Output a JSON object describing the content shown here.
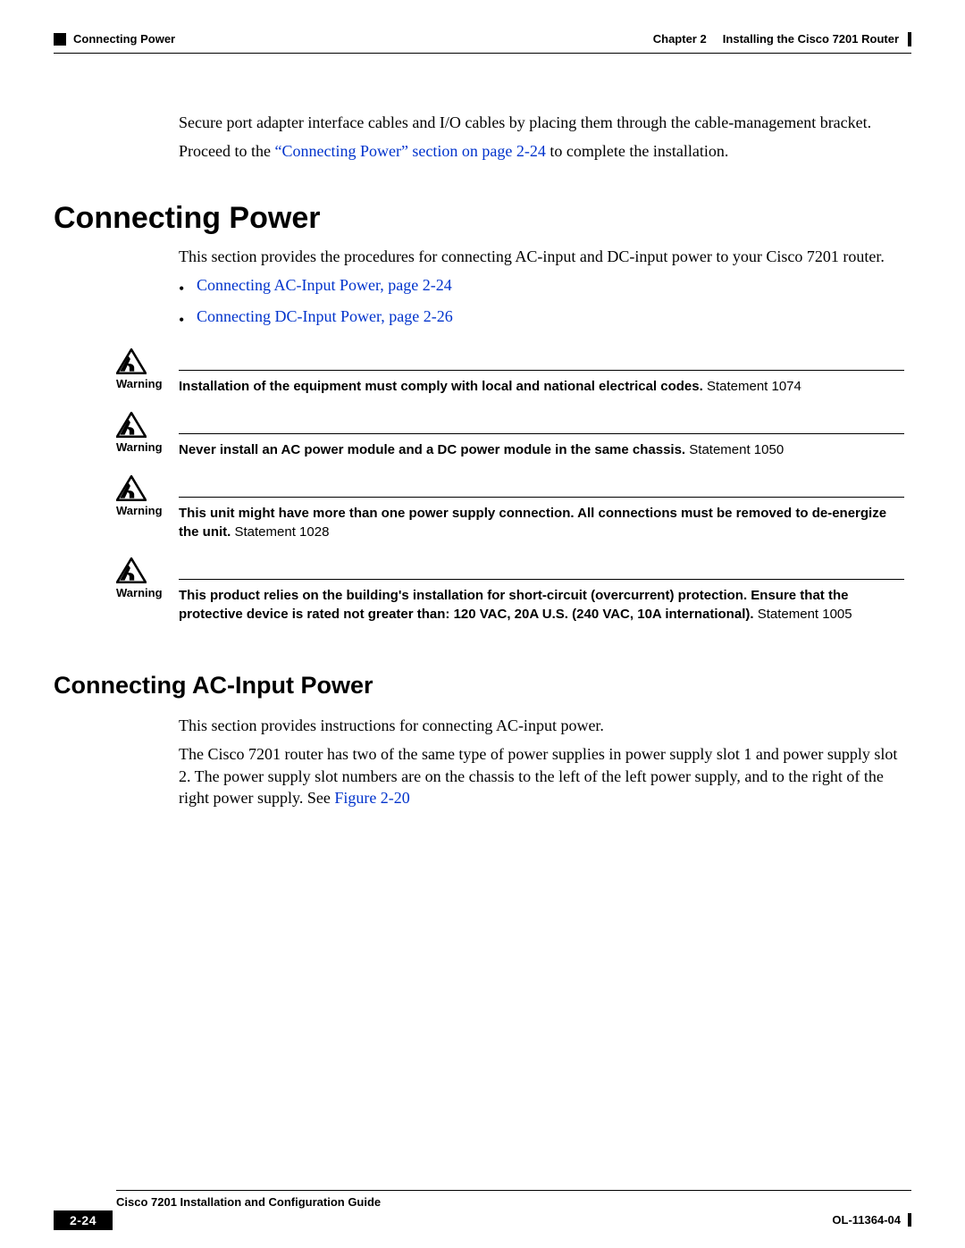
{
  "header": {
    "section_left": "Connecting Power",
    "chapter_label": "Chapter 2",
    "chapter_title": "Installing the Cisco 7201 Router"
  },
  "intro": {
    "p1": "Secure port adapter interface cables and I/O cables by placing them through the cable-management bracket.",
    "p2_pre": "Proceed to the ",
    "p2_link": "“Connecting Power” section on page 2-24",
    "p2_post": " to complete the installation."
  },
  "h1": "Connecting Power",
  "section_intro": "This section provides the procedures for connecting AC-input and DC-input power to your Cisco 7201 router.",
  "bullets": [
    "Connecting AC-Input Power, page 2-24",
    "Connecting DC-Input Power, page 2-26"
  ],
  "warnings": [
    {
      "label": "Warning",
      "bold": "Installation of the equipment must comply with local and national electrical codes.",
      "stmt": "Statement 1074"
    },
    {
      "label": "Warning",
      "bold": "Never install an AC power module and a DC power module in the same chassis.",
      "stmt": "Statement 1050"
    },
    {
      "label": "Warning",
      "bold": "This unit might have more than one power supply connection. All connections must be removed to de-energize the unit.",
      "stmt": "Statement 1028"
    },
    {
      "label": "Warning",
      "bold": "This product relies on the building's installation for short-circuit (overcurrent) protection. Ensure that the protective device is rated not greater than: 120 VAC, 20A U.S. (240 VAC, 10A international).",
      "stmt": "Statement 1005"
    }
  ],
  "h2": "Connecting AC-Input Power",
  "ac": {
    "p1": "This section provides instructions for connecting AC-input power.",
    "p2_pre": "The Cisco 7201 router has two of the same type of power supplies in power supply slot 1 and power supply slot 2. The power supply slot numbers are on the chassis to the left of the left power supply, and to the right of the right power supply. See ",
    "p2_link": "Figure 2-20"
  },
  "footer": {
    "guide_title": "Cisco 7201 Installation and Configuration Guide",
    "page_number": "2-24",
    "doc_id": "OL-11364-04"
  }
}
